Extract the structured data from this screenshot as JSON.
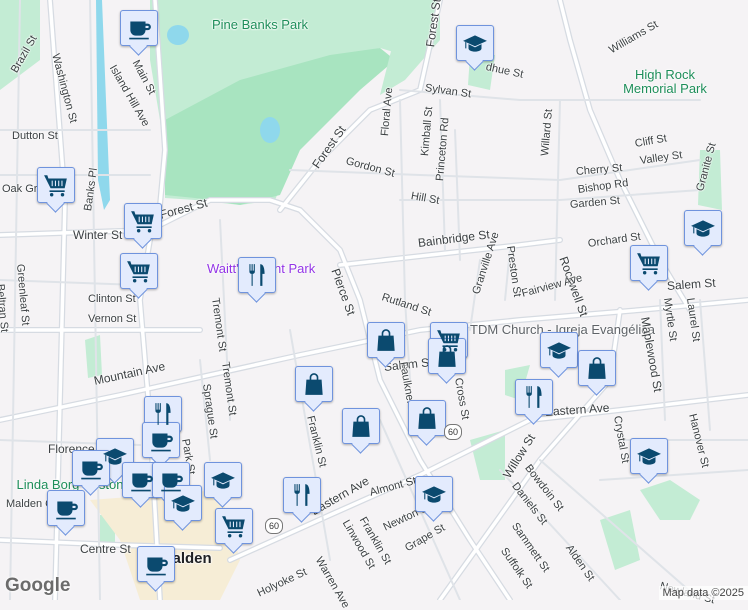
{
  "colors": {
    "background": "#f5f3f5",
    "park": "#c3ecd4",
    "park_dark": "#a8e4c0",
    "water": "#8fd8ec",
    "road": "#ffffff",
    "road_edge": "#d6dbe2",
    "marker_fill": "#e3ebfd",
    "marker_border": "#6f93dd",
    "icon": "#0b4a6f"
  },
  "labels": [
    {
      "text": "Pine Banks Park",
      "kind": "park"
    },
    {
      "text": "High Rock Memorial Park",
      "kind": "park"
    },
    {
      "text": "Waitt's Mount Park",
      "kind": "poi"
    },
    {
      "text": "TDM Church - Igreja Evangélica",
      "kind": "church"
    },
    {
      "text": "Linda Borg Boston",
      "kind": "park"
    },
    {
      "text": "Malden Center",
      "kind": "street"
    },
    {
      "text": "Malden",
      "kind": "city"
    },
    {
      "text": "Brazil St",
      "kind": "street"
    },
    {
      "text": "Washington St",
      "kind": "street"
    },
    {
      "text": "Main St",
      "kind": "street"
    },
    {
      "text": "Island Hill Ave",
      "kind": "street"
    },
    {
      "text": "Dutton St",
      "kind": "street"
    },
    {
      "text": "Oak Grove",
      "kind": "street"
    },
    {
      "text": "Banks Pl",
      "kind": "street"
    },
    {
      "text": "Winter St",
      "kind": "big"
    },
    {
      "text": "Forest St",
      "kind": "big"
    },
    {
      "text": "Forest St",
      "kind": "big"
    },
    {
      "text": "Forest St",
      "kind": "big"
    },
    {
      "text": "Gordon St",
      "kind": "street"
    },
    {
      "text": "Pierce St",
      "kind": "big"
    },
    {
      "text": "Sylvan St",
      "kind": "street"
    },
    {
      "text": "dhue St",
      "kind": "street"
    },
    {
      "text": "Williams St",
      "kind": "street"
    },
    {
      "text": "Floral Ave",
      "kind": "street"
    },
    {
      "text": "Kimball St",
      "kind": "street"
    },
    {
      "text": "Princeton Rd",
      "kind": "street"
    },
    {
      "text": "Hill St",
      "kind": "street"
    },
    {
      "text": "Willard St",
      "kind": "street"
    },
    {
      "text": "Cliff St",
      "kind": "street"
    },
    {
      "text": "Cherry St",
      "kind": "street"
    },
    {
      "text": "Valley St",
      "kind": "street"
    },
    {
      "text": "Bishop Rd",
      "kind": "street"
    },
    {
      "text": "Garden St",
      "kind": "street"
    },
    {
      "text": "Granite St",
      "kind": "street"
    },
    {
      "text": "Bainbridge St",
      "kind": "big"
    },
    {
      "text": "Rockwell St",
      "kind": "big"
    },
    {
      "text": "Orchard St",
      "kind": "street"
    },
    {
      "text": "Preston St",
      "kind": "street"
    },
    {
      "text": "Granville Ave",
      "kind": "street"
    },
    {
      "text": "Fairview Ave",
      "kind": "street"
    },
    {
      "text": "Rutland St",
      "kind": "street"
    },
    {
      "text": "Salem St",
      "kind": "big"
    },
    {
      "text": "Salem St",
      "kind": "big"
    },
    {
      "text": "Maplewood St",
      "kind": "big"
    },
    {
      "text": "Myrtle St",
      "kind": "street"
    },
    {
      "text": "Laurel St",
      "kind": "street"
    },
    {
      "text": "Clinton St",
      "kind": "street"
    },
    {
      "text": "Vernon St",
      "kind": "street"
    },
    {
      "text": "Tremont St",
      "kind": "street"
    },
    {
      "text": "Tremont St",
      "kind": "street"
    },
    {
      "text": "Sprague St",
      "kind": "street"
    },
    {
      "text": "Park St",
      "kind": "street"
    },
    {
      "text": "Mountain Ave",
      "kind": "big"
    },
    {
      "text": "Florence St",
      "kind": "big"
    },
    {
      "text": "Franklin St",
      "kind": "street"
    },
    {
      "text": "Eastern Ave",
      "kind": "big"
    },
    {
      "text": "Eastern Ave",
      "kind": "big"
    },
    {
      "text": "Faulkner St",
      "kind": "street"
    },
    {
      "text": "Cross St",
      "kind": "street"
    },
    {
      "text": "Crystal St",
      "kind": "street"
    },
    {
      "text": "Hanover St",
      "kind": "street"
    },
    {
      "text": "Willow St",
      "kind": "big"
    },
    {
      "text": "Bowdoin St",
      "kind": "street"
    },
    {
      "text": "Daniels St",
      "kind": "street"
    },
    {
      "text": "Almont St",
      "kind": "street"
    },
    {
      "text": "Newton St",
      "kind": "street"
    },
    {
      "text": "Grape St",
      "kind": "street"
    },
    {
      "text": "Sammett St",
      "kind": "street"
    },
    {
      "text": "Suffolk St",
      "kind": "street"
    },
    {
      "text": "Alden St",
      "kind": "street"
    },
    {
      "text": "Newland St",
      "kind": "street"
    },
    {
      "text": "Linwood St",
      "kind": "street"
    },
    {
      "text": "Franklin St",
      "kind": "street"
    },
    {
      "text": "Warren Ave",
      "kind": "street"
    },
    {
      "text": "Holyoke St",
      "kind": "street"
    },
    {
      "text": "Centre St",
      "kind": "big"
    },
    {
      "text": "Greenleaf St",
      "kind": "street"
    },
    {
      "text": "Beltran St",
      "kind": "street"
    }
  ],
  "markers": [
    {
      "icon": "coffee-icon"
    },
    {
      "icon": "school-icon"
    },
    {
      "icon": "cart-icon"
    },
    {
      "icon": "cart-icon"
    },
    {
      "icon": "cart-icon"
    },
    {
      "icon": "restaurant-icon"
    },
    {
      "icon": "cart-icon"
    },
    {
      "icon": "school-icon"
    },
    {
      "icon": "bag-icon"
    },
    {
      "icon": "cart-icon"
    },
    {
      "icon": "bag-icon"
    },
    {
      "icon": "bag-icon"
    },
    {
      "icon": "school-icon"
    },
    {
      "icon": "bag-icon"
    },
    {
      "icon": "restaurant-icon"
    },
    {
      "icon": "bag-icon"
    },
    {
      "icon": "bag-icon"
    },
    {
      "icon": "school-icon"
    },
    {
      "icon": "school-icon"
    },
    {
      "icon": "restaurant-icon"
    },
    {
      "icon": "restaurant-icon"
    },
    {
      "icon": "school-icon"
    },
    {
      "icon": "coffee-icon"
    },
    {
      "icon": "coffee-icon"
    },
    {
      "icon": "coffee-icon"
    },
    {
      "icon": "coffee-icon"
    },
    {
      "icon": "school-icon"
    },
    {
      "icon": "school-icon"
    },
    {
      "icon": "cart-icon"
    },
    {
      "icon": "coffee-icon"
    }
  ],
  "route_shields": [
    "60",
    "60"
  ],
  "attribution": {
    "logo": "Google",
    "map_data": "Map data ©2025"
  }
}
